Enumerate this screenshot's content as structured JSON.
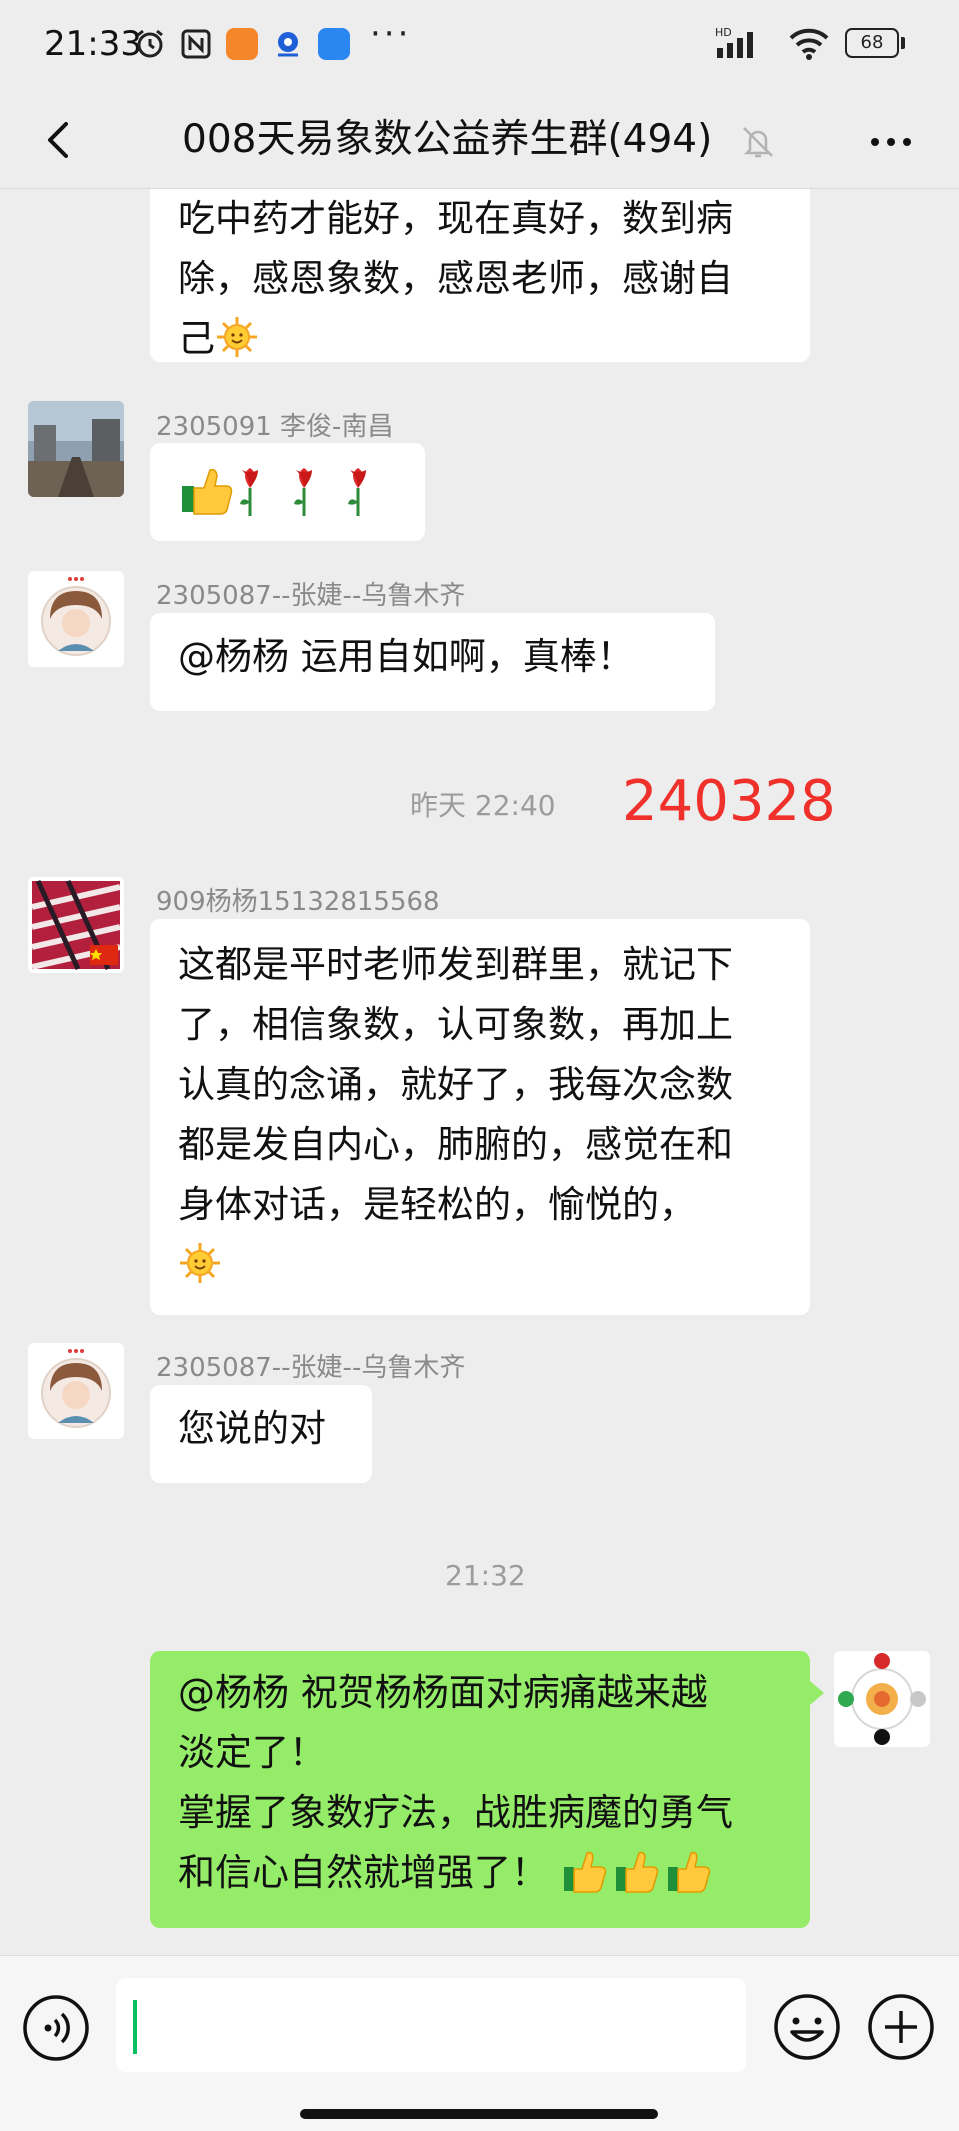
{
  "status_bar": {
    "time": "21:33",
    "icons": [
      "alarm-icon",
      "nfc-icon",
      "app-orange-icon",
      "app-blue-logo-icon",
      "app-blue-square-icon"
    ],
    "overflow": "···",
    "network": "HD",
    "battery": "68"
  },
  "header": {
    "title": "008天易象数公益养生群(494)",
    "back_icon": "chevron-left-icon",
    "mute_icon": "bell-muted-icon",
    "more_icon": "more-dots-icon"
  },
  "messages": [
    {
      "type": "received",
      "lines": [
        "吃中药才能好，现在真好，数到病",
        "除，感恩象数，感恩老师，感谢自",
        "己"
      ]
    },
    {
      "type": "received",
      "sender": "2305091 李俊-南昌"
    },
    {
      "type": "received",
      "sender": "2305087--张婕--乌鲁木齐",
      "text": "@杨杨  运用自如啊，真棒！"
    },
    {
      "type": "timestamp",
      "text": "昨天 22:40"
    },
    {
      "type": "received",
      "sender": "909杨杨15132815568",
      "lines": [
        "这都是平时老师发到群里，就记下",
        "了，相信象数，认可象数，再加上",
        "认真的念诵，就好了，我每次念数",
        "都是发自内心，肺腑的，感觉在和",
        "身体对话，是轻松的，愉悦的，"
      ]
    },
    {
      "type": "received",
      "sender": "2305087--张婕--乌鲁木齐",
      "text": "您说的对"
    },
    {
      "type": "timestamp",
      "text": "21:32"
    },
    {
      "type": "sent",
      "lines": [
        "@杨杨  祝贺杨杨面对病痛越来越",
        "淡定了！",
        "掌握了象数疗法，战胜病魔的勇气",
        "和信心自然就增强了！"
      ]
    }
  ],
  "annotation": "240328",
  "input_bar": {
    "value": "",
    "voice_icon": "voice-icon",
    "emoji_icon": "emoji-icon",
    "plus_icon": "plus-icon"
  },
  "colors": {
    "background": "#ededed",
    "sent_bubble": "#95ec69",
    "received_bubble": "#ffffff",
    "annotation": "#f0302a",
    "caret": "#07c160"
  }
}
